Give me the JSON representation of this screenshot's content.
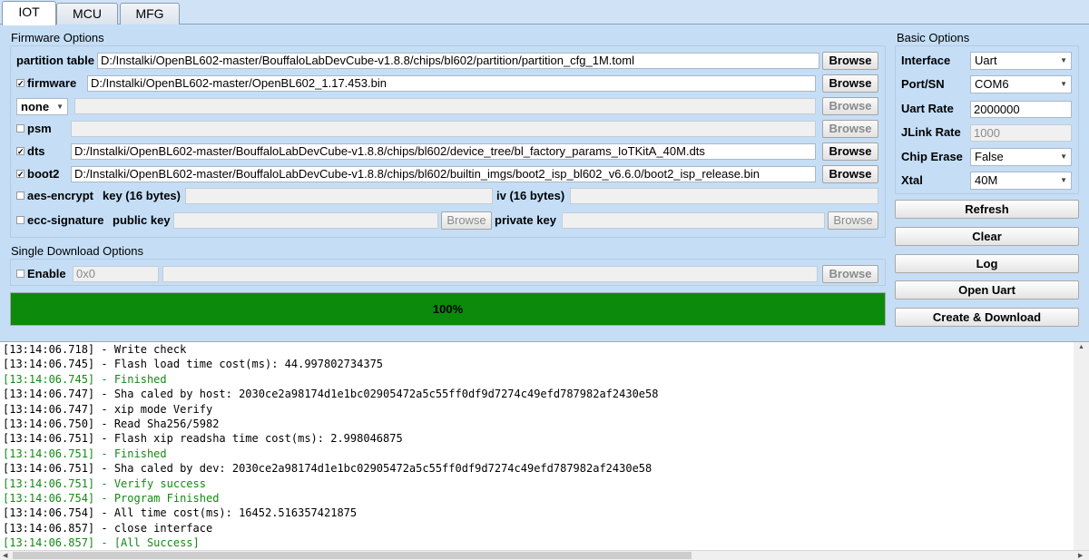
{
  "tabs": [
    {
      "label": "IOT"
    },
    {
      "label": "MCU"
    },
    {
      "label": "MFG"
    }
  ],
  "firmware_options": {
    "title": "Firmware Options",
    "partition_table": {
      "label": "partition table",
      "value": "D:/Instalki/OpenBL602-master/BouffaloLabDevCube-v1.8.8/chips/bl602/partition/partition_cfg_1M.toml",
      "browse": "Browse"
    },
    "firmware": {
      "label": "firmware",
      "checked": "✓",
      "value": "D:/Instalki/OpenBL602-master/OpenBL602_1.17.453.bin",
      "browse": "Browse"
    },
    "none_row": {
      "select": "none",
      "value": "",
      "browse": "Browse"
    },
    "psm": {
      "label": "psm",
      "value": "",
      "browse": "Browse"
    },
    "dts": {
      "label": "dts",
      "checked": "✓",
      "value": "D:/Instalki/OpenBL602-master/BouffaloLabDevCube-v1.8.8/chips/bl602/device_tree/bl_factory_params_IoTKitA_40M.dts",
      "browse": "Browse"
    },
    "boot2": {
      "label": "boot2",
      "checked": "✓",
      "value": "D:/Instalki/OpenBL602-master/BouffaloLabDevCube-v1.8.8/chips/bl602/builtin_imgs/boot2_isp_bl602_v6.6.0/boot2_isp_release.bin",
      "browse": "Browse"
    },
    "aes": {
      "label": "aes-encrypt",
      "key_label": "key (16 bytes)",
      "iv_label": "iv (16 bytes)"
    },
    "ecc": {
      "label": "ecc-signature",
      "public_label": "public key",
      "private_label": "private key",
      "browse": "Browse"
    }
  },
  "single_download": {
    "title": "Single Download Options",
    "enable_label": "Enable",
    "address": "0x0",
    "browse": "Browse"
  },
  "progress": {
    "text": "100%",
    "fraction": 1.0,
    "color": "#0b8a0b"
  },
  "basic_options": {
    "title": "Basic Options",
    "interface": {
      "label": "Interface",
      "value": "Uart"
    },
    "port": {
      "label": "Port/SN",
      "value": "COM6"
    },
    "uart_rate": {
      "label": "Uart Rate",
      "value": "2000000"
    },
    "jlink_rate": {
      "label": "JLink Rate",
      "value": "1000"
    },
    "chip_erase": {
      "label": "Chip Erase",
      "value": "False"
    },
    "xtal": {
      "label": "Xtal",
      "value": "40M"
    }
  },
  "actions": {
    "refresh": "Refresh",
    "clear": "Clear",
    "log": "Log",
    "open_uart": "Open Uart",
    "create_download": "Create & Download"
  },
  "log": [
    {
      "text": "[13:14:06.718] - Write check",
      "green": false
    },
    {
      "text": "[13:14:06.745] - Flash load time cost(ms): 44.997802734375",
      "green": false
    },
    {
      "text": "[13:14:06.745] - Finished",
      "green": true
    },
    {
      "text": "[13:14:06.747] - Sha caled by host: 2030ce2a98174d1e1bc02905472a5c55ff0df9d7274c49efd787982af2430e58",
      "green": false
    },
    {
      "text": "[13:14:06.747] - xip mode Verify",
      "green": false
    },
    {
      "text": "[13:14:06.750] - Read Sha256/5982",
      "green": false
    },
    {
      "text": "[13:14:06.751] - Flash xip readsha time cost(ms): 2.998046875",
      "green": false
    },
    {
      "text": "[13:14:06.751] - Finished",
      "green": true
    },
    {
      "text": "[13:14:06.751] - Sha caled by dev: 2030ce2a98174d1e1bc02905472a5c55ff0df9d7274c49efd787982af2430e58",
      "green": false
    },
    {
      "text": "[13:14:06.751] - Verify success",
      "green": true
    },
    {
      "text": "[13:14:06.754] - Program Finished",
      "green": true
    },
    {
      "text": "[13:14:06.754] - All time cost(ms): 16452.516357421875",
      "green": false
    },
    {
      "text": "[13:14:06.857] - close interface",
      "green": false
    },
    {
      "text": "[13:14:06.857] - [All Success]",
      "green": true
    }
  ]
}
